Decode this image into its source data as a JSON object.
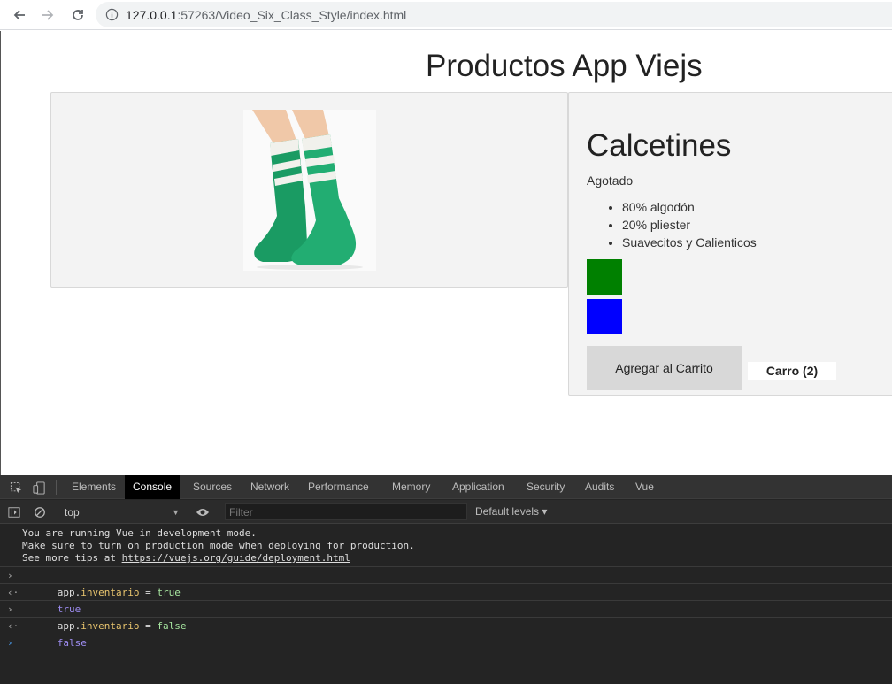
{
  "browser": {
    "url_host": "127.0.0.1",
    "url_rest": ":57263/Video_Six_Class_Style/index.html"
  },
  "page": {
    "title": "Productos App Viejs",
    "product": {
      "name": "Calcetines",
      "stock_status": "Agotado",
      "details": [
        "80% algodón",
        "20% pliester",
        "Suavecitos y Calienticos"
      ],
      "variants": [
        {
          "color": "#008000",
          "name": "green"
        },
        {
          "color": "#0000ff",
          "name": "blue"
        }
      ],
      "image_colors": {
        "sock": "#1fa16a",
        "stripe": "#f1f1ec",
        "skin": "#f0c8a8"
      },
      "add_to_cart_label": "Agregar al Carrito",
      "cart_label": "Carro (2)"
    }
  },
  "devtools": {
    "tabs": [
      "Elements",
      "Console",
      "Sources",
      "Network",
      "Performance",
      "Memory",
      "Application",
      "Security",
      "Audits",
      "Vue"
    ],
    "active_tab": "Console",
    "context": "top",
    "filter_placeholder": "Filter",
    "levels_label": "Default levels ▾",
    "info_message": {
      "line1": "You are running Vue in development mode.",
      "line2": "Make sure to turn on production mode when deploying for production.",
      "line3_prefix": "See more tips at ",
      "line3_link": "https://vuejs.org/guide/deployment.html"
    },
    "entries": [
      {
        "obj": "app.",
        "prop": "inventario",
        "op": " = ",
        "value": "true",
        "result": "true"
      },
      {
        "obj": "app.",
        "prop": "inventario",
        "op": " = ",
        "value": "false",
        "result": "false"
      }
    ]
  }
}
